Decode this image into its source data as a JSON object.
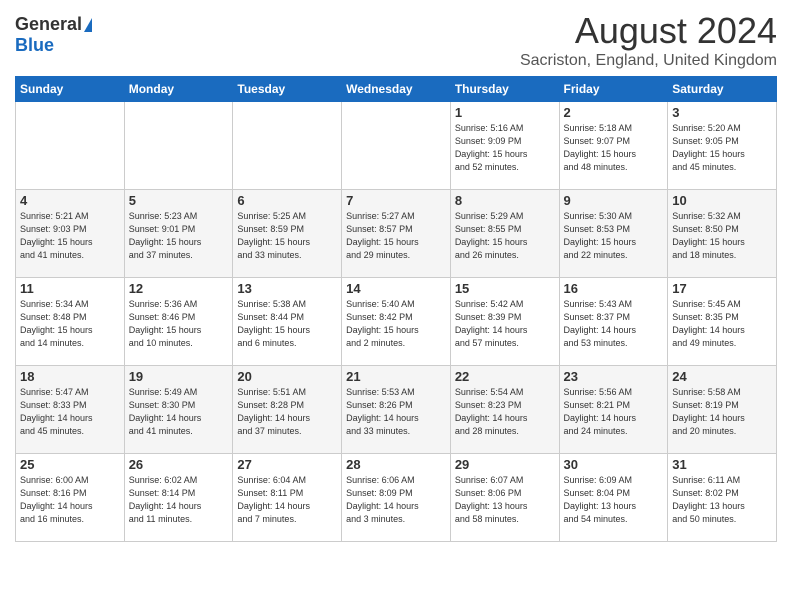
{
  "header": {
    "logo_general": "General",
    "logo_blue": "Blue",
    "month": "August 2024",
    "location": "Sacriston, England, United Kingdom"
  },
  "weekdays": [
    "Sunday",
    "Monday",
    "Tuesday",
    "Wednesday",
    "Thursday",
    "Friday",
    "Saturday"
  ],
  "weeks": [
    [
      {
        "day": "",
        "info": ""
      },
      {
        "day": "",
        "info": ""
      },
      {
        "day": "",
        "info": ""
      },
      {
        "day": "",
        "info": ""
      },
      {
        "day": "1",
        "info": "Sunrise: 5:16 AM\nSunset: 9:09 PM\nDaylight: 15 hours\nand 52 minutes."
      },
      {
        "day": "2",
        "info": "Sunrise: 5:18 AM\nSunset: 9:07 PM\nDaylight: 15 hours\nand 48 minutes."
      },
      {
        "day": "3",
        "info": "Sunrise: 5:20 AM\nSunset: 9:05 PM\nDaylight: 15 hours\nand 45 minutes."
      }
    ],
    [
      {
        "day": "4",
        "info": "Sunrise: 5:21 AM\nSunset: 9:03 PM\nDaylight: 15 hours\nand 41 minutes."
      },
      {
        "day": "5",
        "info": "Sunrise: 5:23 AM\nSunset: 9:01 PM\nDaylight: 15 hours\nand 37 minutes."
      },
      {
        "day": "6",
        "info": "Sunrise: 5:25 AM\nSunset: 8:59 PM\nDaylight: 15 hours\nand 33 minutes."
      },
      {
        "day": "7",
        "info": "Sunrise: 5:27 AM\nSunset: 8:57 PM\nDaylight: 15 hours\nand 29 minutes."
      },
      {
        "day": "8",
        "info": "Sunrise: 5:29 AM\nSunset: 8:55 PM\nDaylight: 15 hours\nand 26 minutes."
      },
      {
        "day": "9",
        "info": "Sunrise: 5:30 AM\nSunset: 8:53 PM\nDaylight: 15 hours\nand 22 minutes."
      },
      {
        "day": "10",
        "info": "Sunrise: 5:32 AM\nSunset: 8:50 PM\nDaylight: 15 hours\nand 18 minutes."
      }
    ],
    [
      {
        "day": "11",
        "info": "Sunrise: 5:34 AM\nSunset: 8:48 PM\nDaylight: 15 hours\nand 14 minutes."
      },
      {
        "day": "12",
        "info": "Sunrise: 5:36 AM\nSunset: 8:46 PM\nDaylight: 15 hours\nand 10 minutes."
      },
      {
        "day": "13",
        "info": "Sunrise: 5:38 AM\nSunset: 8:44 PM\nDaylight: 15 hours\nand 6 minutes."
      },
      {
        "day": "14",
        "info": "Sunrise: 5:40 AM\nSunset: 8:42 PM\nDaylight: 15 hours\nand 2 minutes."
      },
      {
        "day": "15",
        "info": "Sunrise: 5:42 AM\nSunset: 8:39 PM\nDaylight: 14 hours\nand 57 minutes."
      },
      {
        "day": "16",
        "info": "Sunrise: 5:43 AM\nSunset: 8:37 PM\nDaylight: 14 hours\nand 53 minutes."
      },
      {
        "day": "17",
        "info": "Sunrise: 5:45 AM\nSunset: 8:35 PM\nDaylight: 14 hours\nand 49 minutes."
      }
    ],
    [
      {
        "day": "18",
        "info": "Sunrise: 5:47 AM\nSunset: 8:33 PM\nDaylight: 14 hours\nand 45 minutes."
      },
      {
        "day": "19",
        "info": "Sunrise: 5:49 AM\nSunset: 8:30 PM\nDaylight: 14 hours\nand 41 minutes."
      },
      {
        "day": "20",
        "info": "Sunrise: 5:51 AM\nSunset: 8:28 PM\nDaylight: 14 hours\nand 37 minutes."
      },
      {
        "day": "21",
        "info": "Sunrise: 5:53 AM\nSunset: 8:26 PM\nDaylight: 14 hours\nand 33 minutes."
      },
      {
        "day": "22",
        "info": "Sunrise: 5:54 AM\nSunset: 8:23 PM\nDaylight: 14 hours\nand 28 minutes."
      },
      {
        "day": "23",
        "info": "Sunrise: 5:56 AM\nSunset: 8:21 PM\nDaylight: 14 hours\nand 24 minutes."
      },
      {
        "day": "24",
        "info": "Sunrise: 5:58 AM\nSunset: 8:19 PM\nDaylight: 14 hours\nand 20 minutes."
      }
    ],
    [
      {
        "day": "25",
        "info": "Sunrise: 6:00 AM\nSunset: 8:16 PM\nDaylight: 14 hours\nand 16 minutes."
      },
      {
        "day": "26",
        "info": "Sunrise: 6:02 AM\nSunset: 8:14 PM\nDaylight: 14 hours\nand 11 minutes."
      },
      {
        "day": "27",
        "info": "Sunrise: 6:04 AM\nSunset: 8:11 PM\nDaylight: 14 hours\nand 7 minutes."
      },
      {
        "day": "28",
        "info": "Sunrise: 6:06 AM\nSunset: 8:09 PM\nDaylight: 14 hours\nand 3 minutes."
      },
      {
        "day": "29",
        "info": "Sunrise: 6:07 AM\nSunset: 8:06 PM\nDaylight: 13 hours\nand 58 minutes."
      },
      {
        "day": "30",
        "info": "Sunrise: 6:09 AM\nSunset: 8:04 PM\nDaylight: 13 hours\nand 54 minutes."
      },
      {
        "day": "31",
        "info": "Sunrise: 6:11 AM\nSunset: 8:02 PM\nDaylight: 13 hours\nand 50 minutes."
      }
    ]
  ]
}
